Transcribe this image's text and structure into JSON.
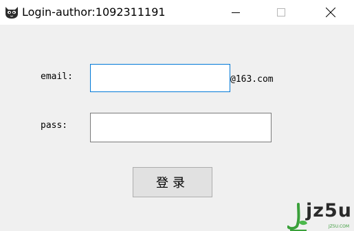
{
  "window": {
    "title": "Login-author:1092311191",
    "controls": [
      "minimize-icon",
      "maximize-icon",
      "close-icon"
    ]
  },
  "form": {
    "email_label": "email:",
    "email_value": "",
    "email_suffix": "@163.com",
    "pass_label": "pass:",
    "pass_value": "",
    "login_button": "登录"
  },
  "watermark": {
    "brand": "jz5u",
    "sub": "JZ5U.COM"
  },
  "colors": {
    "focus_border": "#0078d7",
    "background": "#f0f0f0",
    "watermark_green": "#3a9a3a"
  }
}
